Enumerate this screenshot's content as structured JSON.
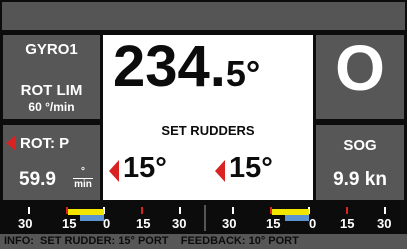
{
  "left_panel": {
    "mode_label": "GYRO1",
    "rot_lim_label": "ROT LIM",
    "rot_lim_value": "60 °/min",
    "rot_label": "ROT: P",
    "rot_value": "59.9",
    "rot_unit_top": "°",
    "rot_unit_bottom": "min"
  },
  "center_panel": {
    "heading_main": "234.",
    "heading_decimal": "5°",
    "status_text": "SET RUDDERS",
    "rudder_port": "15°",
    "rudder_stbd": "15°"
  },
  "right_panel": {
    "mode_letter": "O",
    "sog_label": "SOG",
    "sog_value": "9.9 kn"
  },
  "rudder_scales": [
    {
      "labels": [
        "30",
        "15",
        "0",
        "15",
        "30"
      ],
      "set_value": -15,
      "feedback_value": -10
    },
    {
      "labels": [
        "30",
        "15",
        "0",
        "15",
        "30"
      ],
      "set_value": -15,
      "feedback_value": -10
    }
  ],
  "info_bar": {
    "text": "INFO:  SET RUDDER: 15° PORT    FEEDBACK: 10° PORT"
  },
  "colors": {
    "panel_gray": "#575757",
    "border_black": "#0c0c0c",
    "alert_red": "#d92222",
    "set_bar_yellow": "#f2e500",
    "feedback_bar_blue": "#5a93cf"
  },
  "icons": [
    "port-arrow-icon"
  ]
}
